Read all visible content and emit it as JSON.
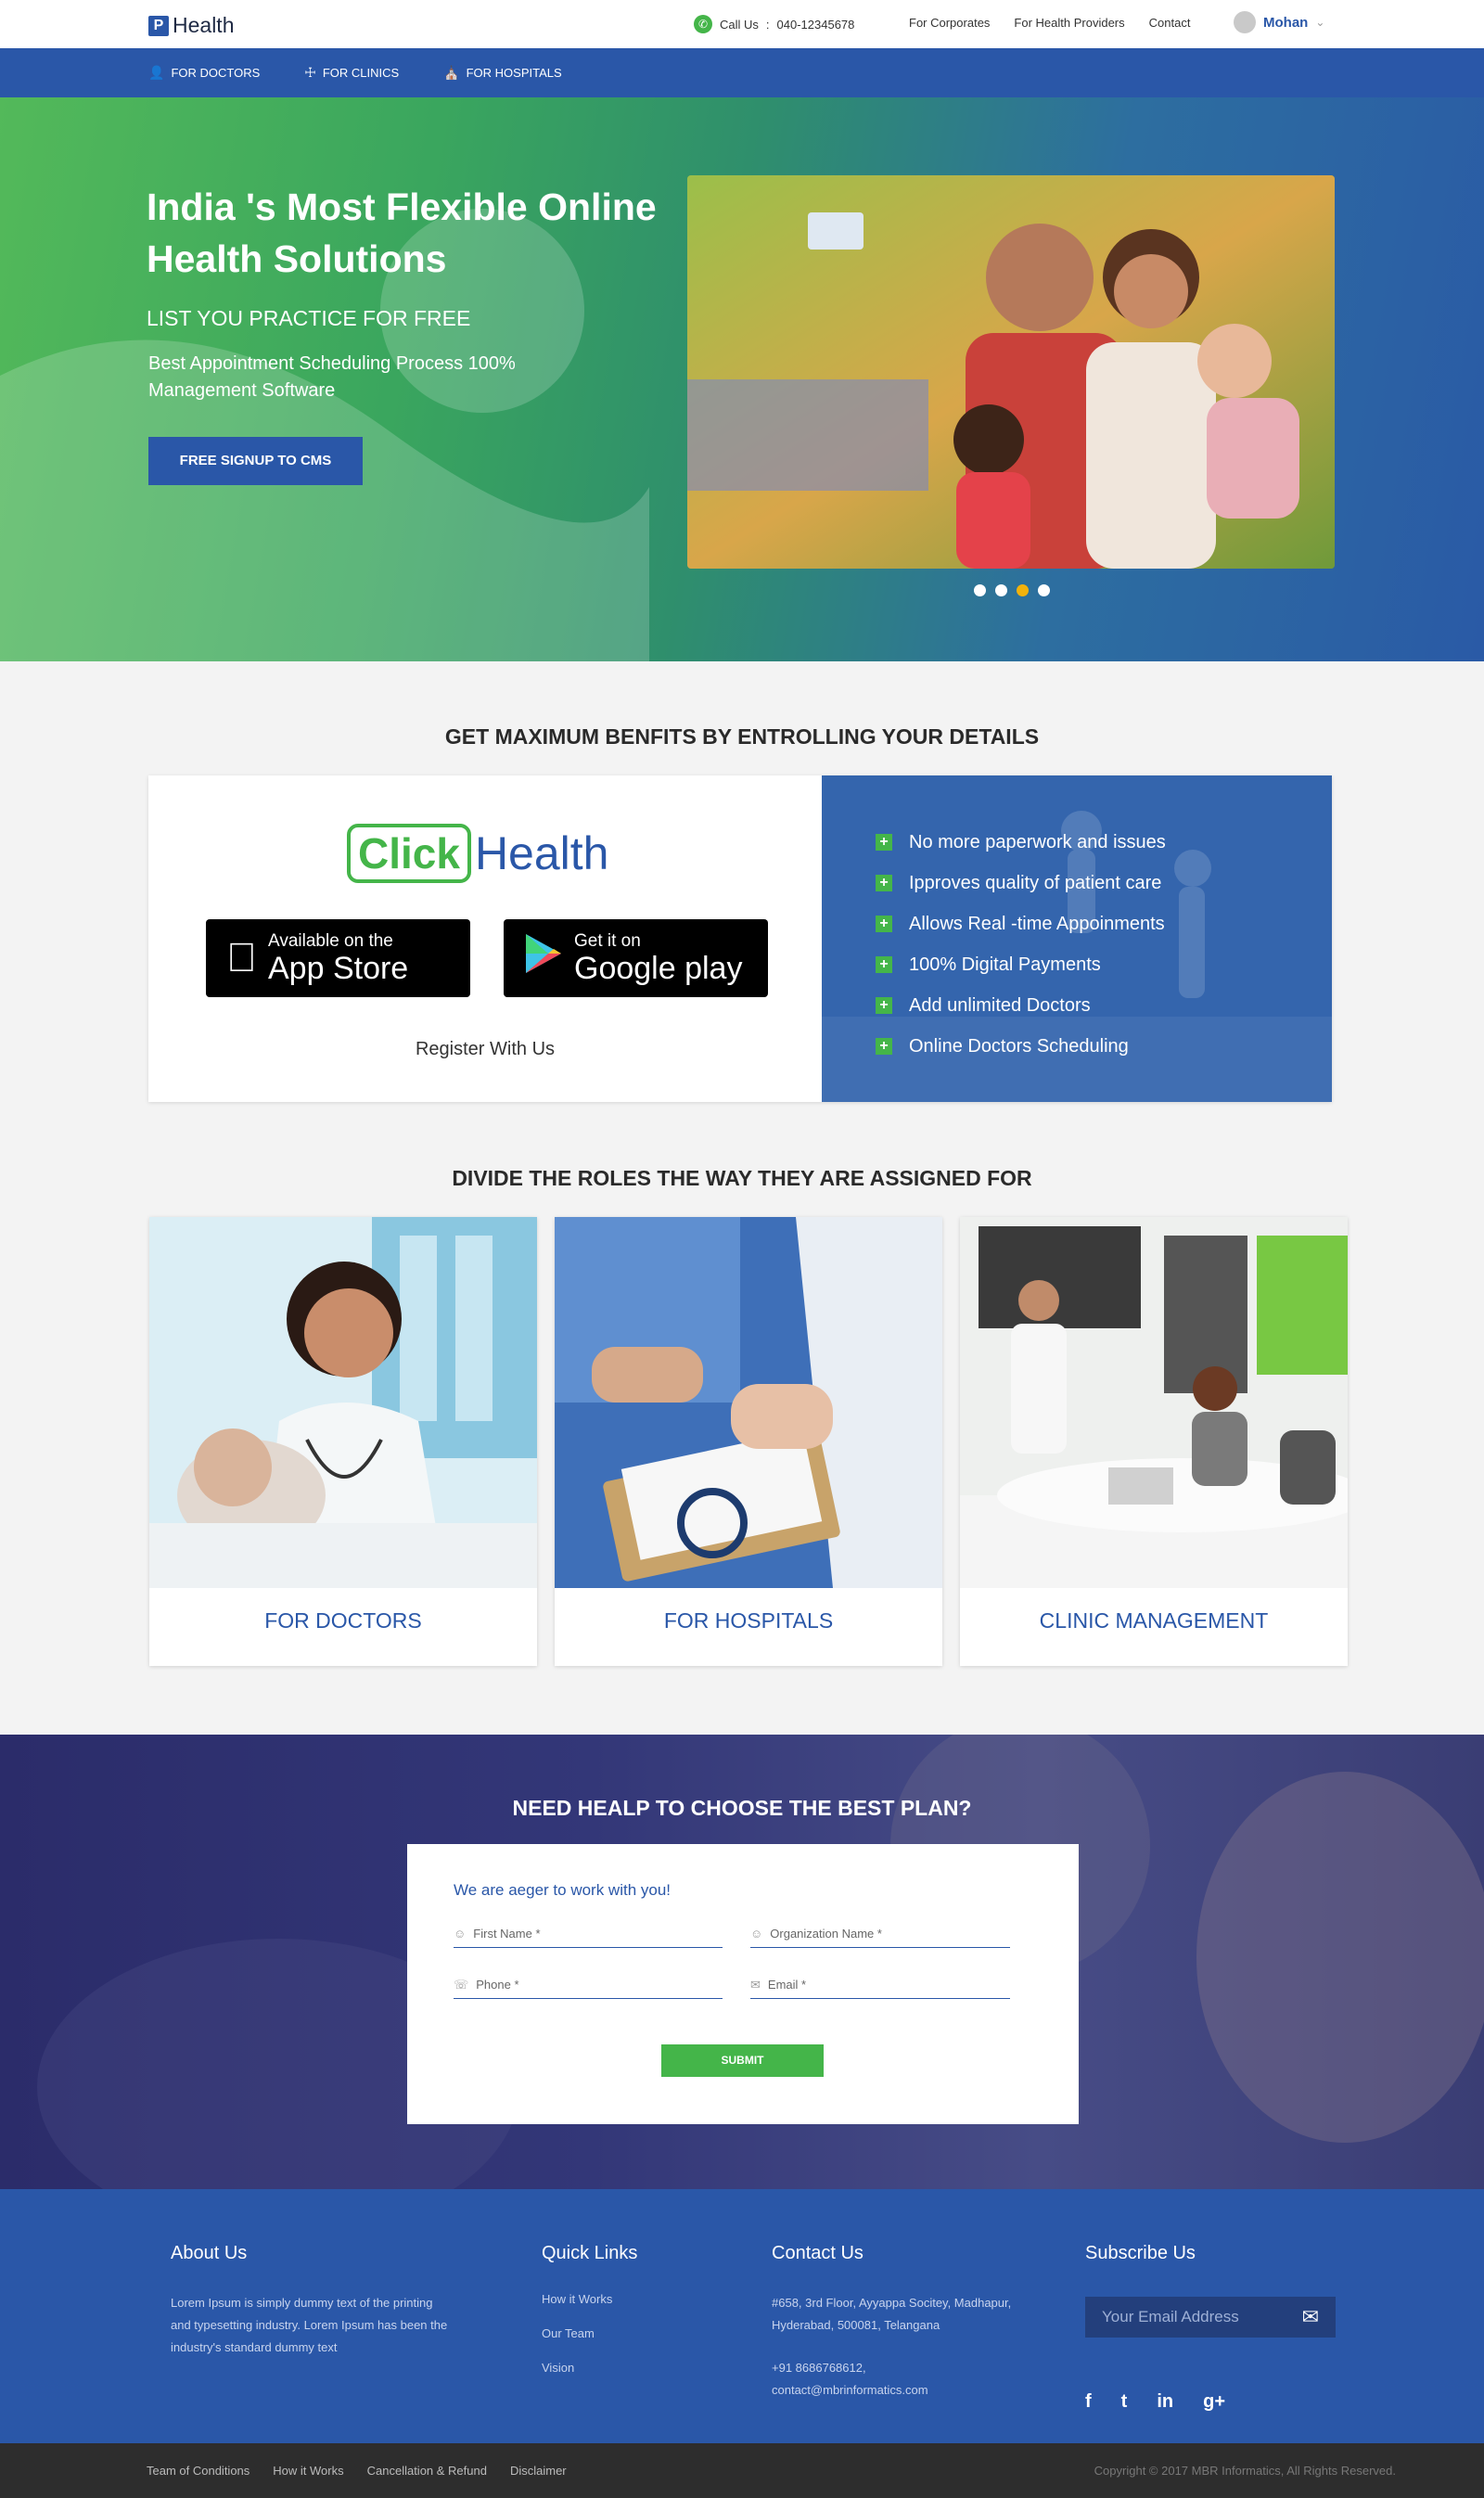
{
  "header": {
    "logo_letter": "P",
    "logo_text": "Health",
    "call_label": "Call Us",
    "call_sep": ":",
    "phone": "040-12345678",
    "links": [
      "For Corporates",
      "For Health Providers",
      "Contact"
    ],
    "user_name": "Mohan"
  },
  "nav": {
    "items": [
      "FOR DOCTORS",
      "FOR CLINICS",
      "FOR HOSPITALS"
    ]
  },
  "hero": {
    "title": "India 's Most Flexible Online Health Solutions",
    "subtitle": "LIST YOU PRACTICE FOR FREE",
    "description": "Best Appointment Scheduling Process 100% Management Software",
    "cta": "FREE SIGNUP TO CMS",
    "slides_total": 4,
    "active_slide": 3
  },
  "benefits": {
    "title": "GET MAXIMUM BENFITS BY ENTROLLING YOUR DETAILS",
    "brand_click": "Click",
    "brand_health": "Health",
    "appstore_small": "Available on the",
    "appstore_big": "App Store",
    "googleplay_small": "Get it on",
    "googleplay_big": "Google play",
    "register": "Register With Us",
    "list": [
      "No more paperwork and issues",
      "Ipproves quality of patient care",
      "Allows Real -time Appoinments",
      "100% Digital Payments",
      "Add unlimited Doctors",
      "Online Doctors Scheduling"
    ]
  },
  "roles": {
    "title": "DIVIDE THE ROLES THE WAY THEY ARE ASSIGNED FOR",
    "cards": [
      "FOR DOCTORS",
      "FOR HOSPITALS",
      "CLINIC MANAGEMENT"
    ]
  },
  "contact_form": {
    "title": "NEED HEALP TO CHOOSE THE BEST PLAN?",
    "heading": "We are aeger to work with you!",
    "first_name": "First Name *",
    "organization": "Organization Name *",
    "phone": "Phone *",
    "email": "Email *",
    "submit": "SUBMIT"
  },
  "footer": {
    "about_title": "About Us",
    "about_text": "Lorem Ipsum is simply dummy text of the printing and typesetting industry. Lorem Ipsum has been the industry's standard dummy text",
    "quick_title": "Quick Links",
    "quick_links": [
      "How it Works",
      "Our Team",
      "Vision"
    ],
    "contact_title": "Contact Us",
    "address": "#658, 3rd Floor, Ayyappa Socitey, Madhapur, Hyderabad, 500081, Telangana",
    "contact_phone": "+91 8686768612,",
    "contact_email": "contact@mbrinformatics.com",
    "subscribe_title": "Subscribe Us",
    "subscribe_placeholder": "Your Email Address",
    "socials": [
      "f",
      "t",
      "in",
      "g+"
    ]
  },
  "bottom": {
    "links": [
      "Team of Conditions",
      "How it Works",
      "Cancellation & Refund",
      "Disclaimer"
    ],
    "copyright": "Copyright © 2017  MBR Informatics, All Rights Reserved."
  },
  "colors": {
    "primary_blue": "#2a57a8",
    "green": "#44b549",
    "dark_band": "#2b2c6a",
    "bottom_bar": "#2d2d2d"
  }
}
